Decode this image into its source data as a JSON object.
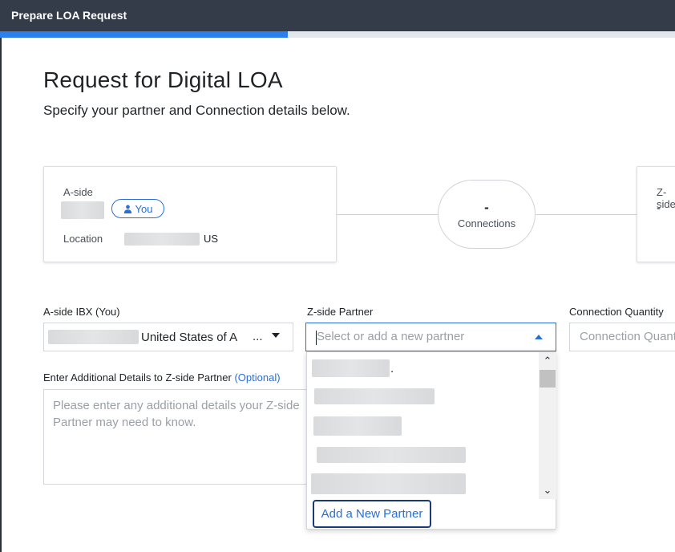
{
  "window": {
    "title": "Prepare LOA Request"
  },
  "progress": {
    "percent": 42.6
  },
  "page": {
    "heading": "Request for Digital LOA",
    "subheading": "Specify your partner and Connection details below."
  },
  "aside_card": {
    "label": "A-side",
    "badge": "You",
    "location_label": "Location",
    "location_suffix": "US"
  },
  "connections": {
    "count": "-",
    "label": "Connections"
  },
  "zside_card": {
    "label": "Z-side",
    "value": "-"
  },
  "form": {
    "aside_ibx_label": "A-side IBX (You)",
    "aside_ibx_value": "United States of A",
    "aside_ibx_ellipsis": "...",
    "zside_partner_label": "Z-side Partner",
    "zside_partner_placeholder": "Select or add a new partner",
    "connection_quantity_label": "Connection Quantity",
    "connection_quantity_placeholder": "Connection Quantity",
    "details_label": "Enter Additional Details to Z-side Partner",
    "details_optional": "(Optional)",
    "details_placeholder": "Please enter any additional details your Z-side Partner may need to know."
  },
  "dropdown": {
    "options_dot": ".",
    "add_new_partner": "Add a New Partner"
  }
}
